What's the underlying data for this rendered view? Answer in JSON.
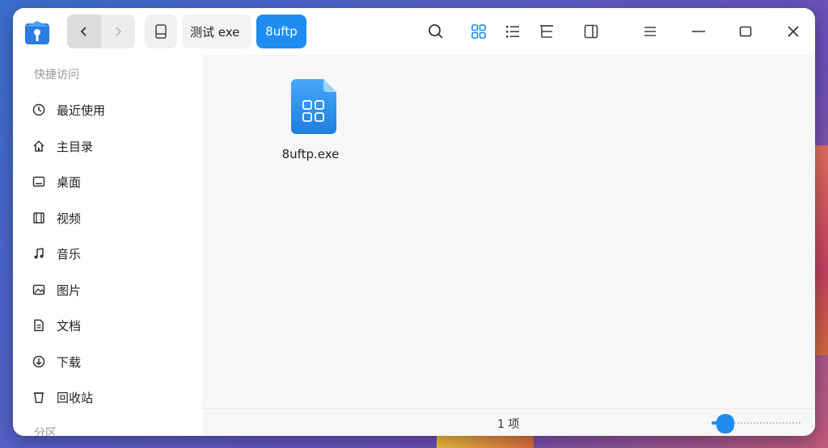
{
  "breadcrumb": {
    "items": [
      "测试 exe",
      "8uftp"
    ]
  },
  "toolbar": {
    "search_icon": "search-icon",
    "icon_view": "grid-view-icon",
    "list_view": "list-view-icon",
    "tree_view": "tree-view-icon",
    "details_panel": "details-panel-icon",
    "menu": "menu-icon",
    "minimize": "minimize-icon",
    "maximize": "maximize-icon",
    "close": "close-icon"
  },
  "sidebar": {
    "section_quick": "快捷访问",
    "items": [
      {
        "label": "最近使用",
        "icon": "clock-icon"
      },
      {
        "label": "主目录",
        "icon": "home-icon"
      },
      {
        "label": "桌面",
        "icon": "desktop-icon"
      },
      {
        "label": "视频",
        "icon": "video-icon"
      },
      {
        "label": "音乐",
        "icon": "music-icon"
      },
      {
        "label": "图片",
        "icon": "picture-icon"
      },
      {
        "label": "文档",
        "icon": "document-icon"
      },
      {
        "label": "下载",
        "icon": "download-icon"
      },
      {
        "label": "回收站",
        "icon": "trash-icon"
      }
    ],
    "section_partition": "分区"
  },
  "files": [
    {
      "name": "8uftp.exe",
      "icon": "executable-file-icon"
    }
  ],
  "status": {
    "count": "1 项",
    "zoom_level": 0.15
  },
  "colors": {
    "accent": "#1f8cf0"
  }
}
